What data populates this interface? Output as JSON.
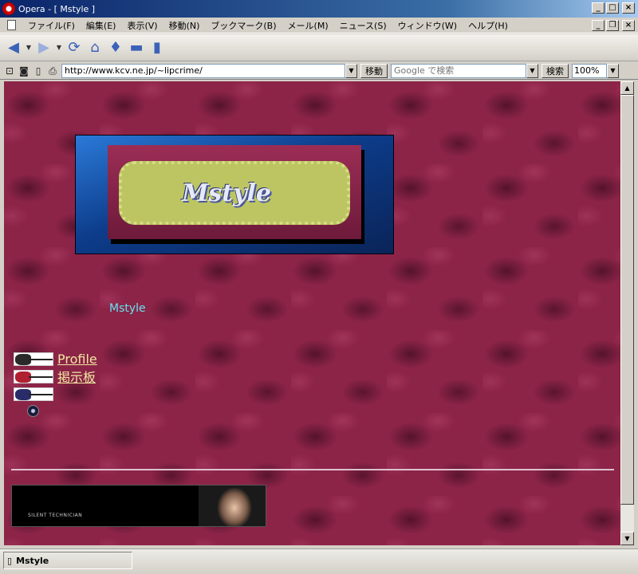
{
  "window": {
    "title": "Opera - [ Mstyle ]"
  },
  "menu": {
    "items": [
      "ファイル(F)",
      "編集(E)",
      "表示(V)",
      "移動(N)",
      "ブックマーク(B)",
      "メール(M)",
      "ニュース(S)",
      "ウィンドウ(W)",
      "ヘルプ(H)"
    ]
  },
  "toolbar": {
    "buttons": [
      "back-icon",
      "forward-icon",
      "reload-icon",
      "home-icon",
      "hotlist-icon",
      "print-icon",
      "new-page-icon"
    ]
  },
  "address": {
    "url": "http://www.kcv.ne.jp/~lipcrime/",
    "go_label": "移動",
    "search_placeholder": "Google で検索",
    "search_label": "検索",
    "zoom": "100%"
  },
  "page": {
    "banner_logo": "Mstyle",
    "site_title": "Mstyle",
    "nav": [
      {
        "label": "Profile",
        "guitar_color": "#2a2a2a"
      },
      {
        "label": "掲示板",
        "guitar_color": "#b02030"
      },
      {
        "label": "",
        "guitar_color": "#2a2c6a"
      }
    ],
    "footer_banner_text": "SILENT TECHNICIAN"
  },
  "status": {
    "tab_title": "Mstyle"
  },
  "colors": {
    "page_background": "#8c2448",
    "site_title": "#66e0f0",
    "nav_link": "#f0e8a0",
    "titlebar": "#0a246a"
  }
}
